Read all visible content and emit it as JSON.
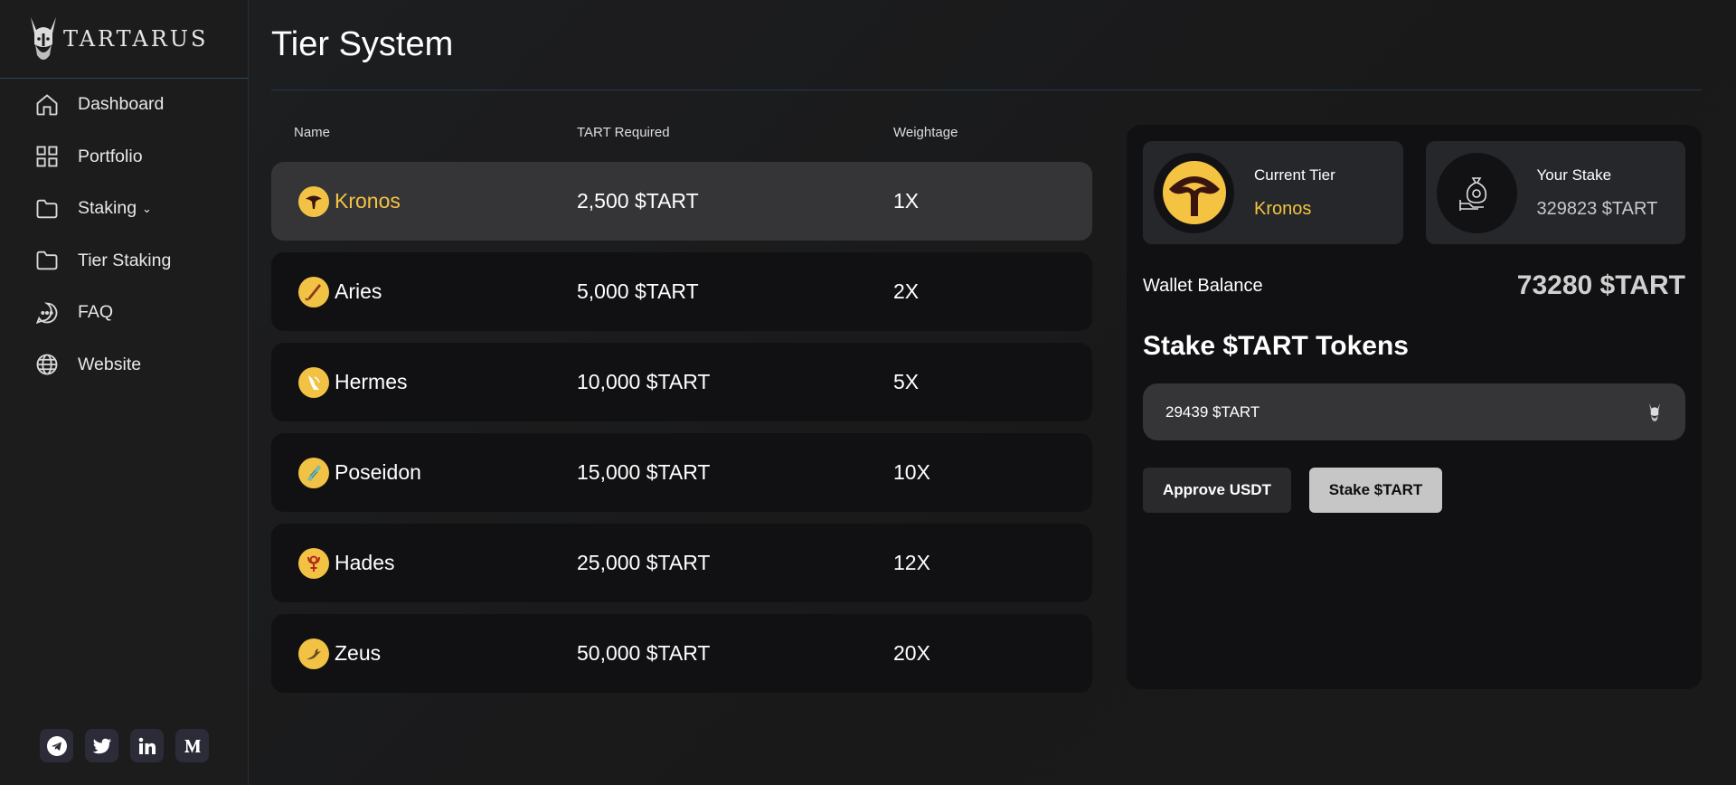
{
  "brand": {
    "name": "TARTARUS"
  },
  "sidebar": {
    "items": [
      {
        "label": "Dashboard",
        "icon": "home-icon"
      },
      {
        "label": "Portfolio",
        "icon": "grid-icon"
      },
      {
        "label": "Staking",
        "icon": "folder-icon",
        "has_dropdown": true
      },
      {
        "label": "Tier Staking",
        "icon": "folder-icon"
      },
      {
        "label": "FAQ",
        "icon": "chat-icon"
      },
      {
        "label": "Website",
        "icon": "globe-icon"
      }
    ],
    "socials": [
      "telegram-icon",
      "twitter-icon",
      "linkedin-icon",
      "medium-icon"
    ]
  },
  "page": {
    "title": "Tier System"
  },
  "table": {
    "headers": {
      "name": "Name",
      "required": "TART Required",
      "weightage": "Weightage"
    },
    "rows": [
      {
        "name": "Kronos",
        "required": "2,500 $TART",
        "weightage": "1X",
        "active": true,
        "icon": "kronos-icon"
      },
      {
        "name": "Aries",
        "required": "5,000 $TART",
        "weightage": "2X",
        "icon": "aries-icon"
      },
      {
        "name": "Hermes",
        "required": "10,000 $TART",
        "weightage": "5X",
        "icon": "hermes-icon"
      },
      {
        "name": "Poseidon",
        "required": "15,000 $TART",
        "weightage": "10X",
        "icon": "poseidon-icon"
      },
      {
        "name": "Hades",
        "required": "25,000 $TART",
        "weightage": "12X",
        "icon": "hades-icon"
      },
      {
        "name": "Zeus",
        "required": "50,000 $TART",
        "weightage": "20X",
        "icon": "zeus-icon"
      }
    ]
  },
  "panel": {
    "current_tier": {
      "label": "Current Tier",
      "value": "Kronos"
    },
    "your_stake": {
      "label": "Your Stake",
      "value": "329823 $TART"
    },
    "wallet": {
      "label": "Wallet Balance",
      "value": "73280 $TART"
    },
    "stake_title": "Stake $TART Tokens",
    "stake_input": {
      "value": "29439 $TART"
    },
    "buttons": {
      "approve": "Approve USDT",
      "stake": "Stake $TART"
    }
  },
  "colors": {
    "accent": "#f5c342",
    "active_row": "#353538",
    "row": "#111113"
  }
}
